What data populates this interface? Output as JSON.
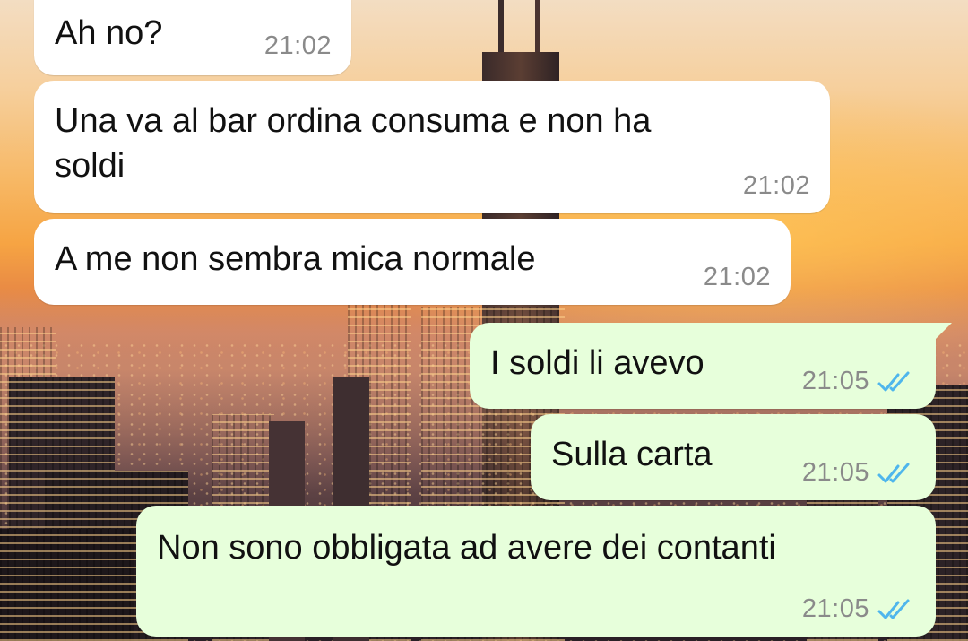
{
  "messages": [
    {
      "direction": "incoming",
      "text": "Ah no?",
      "time": "21:02"
    },
    {
      "direction": "incoming",
      "text": "Una va al bar ordina consuma e non ha\nsoldi",
      "time": "21:02"
    },
    {
      "direction": "incoming",
      "text": "A me non sembra mica normale",
      "time": "21:02"
    },
    {
      "direction": "outgoing",
      "text": "I soldi li avevo",
      "time": "21:05",
      "status": "read"
    },
    {
      "direction": "outgoing",
      "text": "Sulla carta",
      "time": "21:05",
      "status": "read"
    },
    {
      "direction": "outgoing",
      "text": "Non sono obbligata ad avere dei contanti",
      "time": "21:05",
      "status": "read"
    }
  ],
  "colors": {
    "incoming_bubble": "#ffffff",
    "outgoing_bubble": "#e7ffdb",
    "read_ticks": "#4fb6ec",
    "timestamp": "#8a8a8a"
  },
  "icons": {
    "read_status": "double-check-icon"
  }
}
